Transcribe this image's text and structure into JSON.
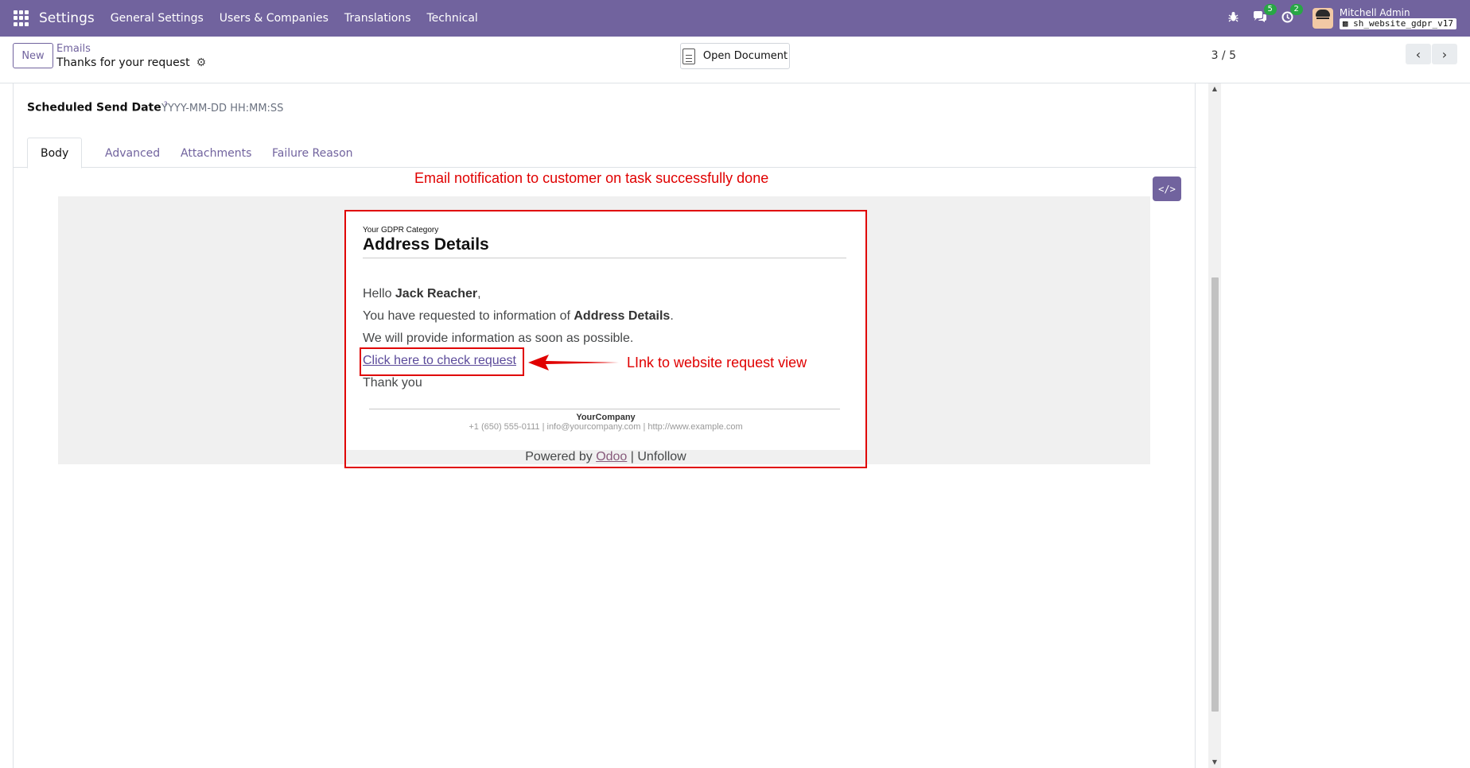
{
  "topbar": {
    "app_title": "Settings",
    "menu": [
      "General Settings",
      "Users & Companies",
      "Translations",
      "Technical"
    ],
    "messages_count": "5",
    "activities_count": "2",
    "user_name": "Mitchell Admin",
    "database": "sh_website_gdpr_v17",
    "accent_color": "#71639e"
  },
  "control_panel": {
    "new_label": "New",
    "breadcrumb": "Emails",
    "record_title": "Thanks for your request",
    "open_document_label": "Open Document",
    "pager": "3 / 5"
  },
  "form": {
    "scheduled_label": "Scheduled Send Date",
    "scheduled_help": "?",
    "scheduled_placeholder": "YYYY-MM-DD HH:MM:SS",
    "tabs": [
      "Body",
      "Advanced",
      "Attachments",
      "Failure Reason"
    ],
    "active_tab": "Body"
  },
  "annotations": {
    "top": "Email notification to customer on task successfully done",
    "link": "LInk to website request view",
    "color": "#e00000"
  },
  "email": {
    "category": "Your GDPR Category",
    "heading": "Address Details",
    "greeting_prefix": "Hello ",
    "customer_name": "Jack Reacher",
    "greeting_suffix": ",",
    "requested_prefix": "You have requested to information of ",
    "requested_item": "Address Details",
    "requested_suffix": ".",
    "provide_text": "We will provide information as soon as possible.",
    "link_text": "Click here to check request",
    "thanks_text": "Thank you",
    "company_name": "YourCompany",
    "company_contact": "+1 (650) 555-0111 | info@yourcompany.com | http://www.example.com",
    "powered_prefix": "Powered by ",
    "powered_brand": "Odoo",
    "powered_suffix": " | Unfollow"
  }
}
